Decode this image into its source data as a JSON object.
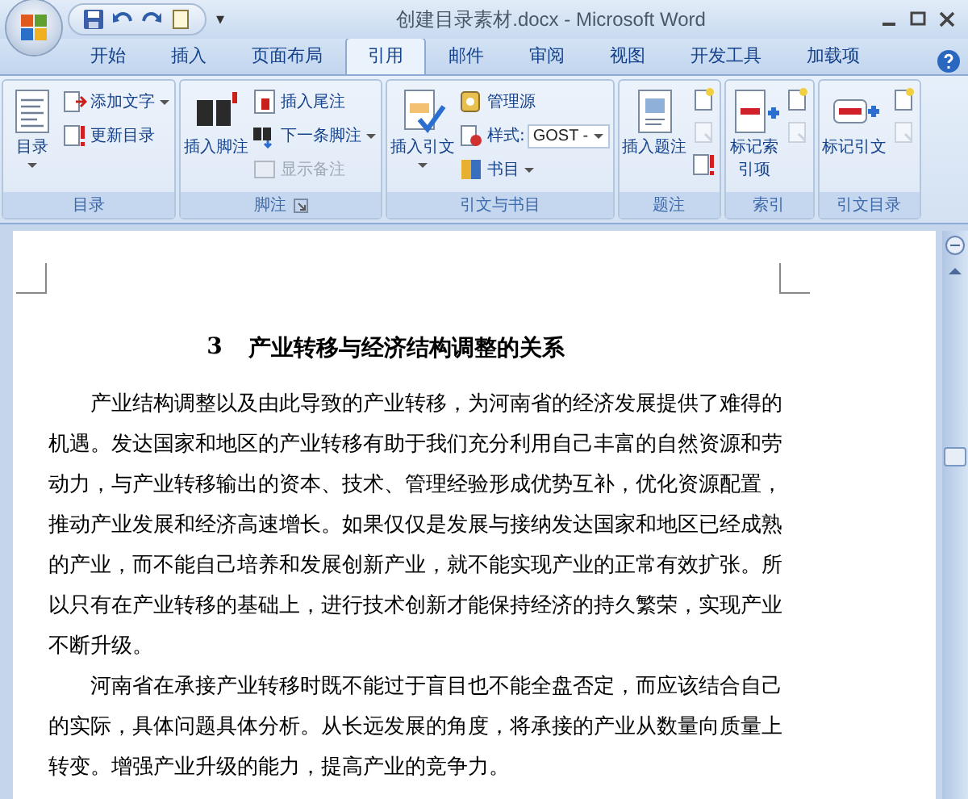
{
  "window": {
    "title": "创建目录素材.docx - Microsoft Word",
    "customize": "▾"
  },
  "tabs": [
    {
      "label": "开始",
      "selected": false
    },
    {
      "label": "插入",
      "selected": false
    },
    {
      "label": "页面布局",
      "selected": false
    },
    {
      "label": "引用",
      "selected": true
    },
    {
      "label": "邮件",
      "selected": false
    },
    {
      "label": "审阅",
      "selected": false
    },
    {
      "label": "视图",
      "selected": false
    },
    {
      "label": "开发工具",
      "selected": false
    },
    {
      "label": "加载项",
      "selected": false
    }
  ],
  "ribbon": [
    {
      "label": "目录",
      "launcher": false,
      "large": {
        "label": "目录",
        "dropdown": true
      },
      "small": [
        {
          "kind": "button",
          "label": "添加文字",
          "dropdown": true,
          "disabled": false
        },
        {
          "kind": "button",
          "label": "更新目录",
          "dropdown": false,
          "disabled": false
        }
      ]
    },
    {
      "label": "脚注",
      "launcher": true,
      "large": {
        "label": "插入脚注",
        "dropdown": false
      },
      "small": [
        {
          "kind": "button",
          "label": "插入尾注",
          "dropdown": false,
          "disabled": false
        },
        {
          "kind": "button",
          "label": "下一条脚注",
          "dropdown": true,
          "disabled": false
        },
        {
          "kind": "button",
          "label": "显示备注",
          "dropdown": false,
          "disabled": true
        }
      ]
    },
    {
      "label": "引文与书目",
      "launcher": false,
      "large": {
        "label": "插入引文",
        "dropdown": true
      },
      "small": [
        {
          "kind": "button",
          "label": "管理源",
          "dropdown": false,
          "disabled": false
        },
        {
          "kind": "field",
          "label": "样式:",
          "value": "GOST - ",
          "dropdown": true,
          "disabled": false
        },
        {
          "kind": "button",
          "label": "书目",
          "dropdown": true,
          "disabled": false
        }
      ]
    },
    {
      "label": "题注",
      "launcher": false,
      "large": {
        "label": "插入题注",
        "dropdown": false
      },
      "small": [
        {
          "kind": "icon",
          "disabled": false
        },
        {
          "kind": "icon",
          "disabled": true
        },
        {
          "kind": "icon",
          "disabled": false
        }
      ]
    },
    {
      "label": "索引",
      "launcher": false,
      "large": {
        "label": "标记索引项",
        "dropdown": false
      },
      "small": [
        {
          "kind": "icon",
          "disabled": false
        },
        {
          "kind": "icon",
          "disabled": true
        }
      ]
    },
    {
      "label": "引文目录",
      "launcher": false,
      "large": {
        "label": "标记引文",
        "dropdown": false
      },
      "small": [
        {
          "kind": "icon",
          "disabled": false
        },
        {
          "kind": "icon",
          "disabled": true
        }
      ]
    }
  ],
  "document": {
    "heading_number": "3",
    "heading": "产业转移与经济结构调整的关系",
    "paragraphs": [
      "产业结构调整以及由此导致的产业转移，为河南省的经济发展提供了难得的机遇。发达国家和地区的产业转移有助于我们充分利用自己丰富的自然资源和劳动力，与产业转移输出的资本、技术、管理经验形成优势互补，优化资源配置，推动产业发展和经济高速增长。如果仅仅是发展与接纳发达国家和地区已经成熟的产业，而不能自己培养和发展创新产业，就不能实现产业的正常有效扩张。所以只有在产业转移的基础上，进行技术创新才能保持经济的持久繁荣，实现产业不断升级。",
      "河南省在承接产业转移时既不能过于盲目也不能全盘否定，而应该结合自己的实际，具体问题具体分析。从长远发展的角度，将承接的产业从数量向质量上转变。增强产业升级的能力，提高产业的竞争力。"
    ]
  }
}
